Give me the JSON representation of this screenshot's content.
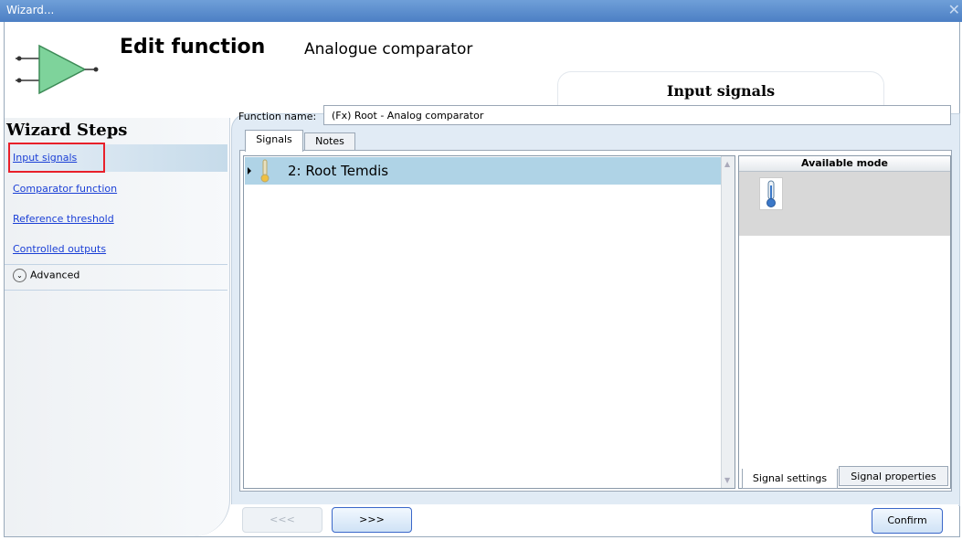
{
  "window": {
    "title": "Wizard...",
    "close_glyph": "✕"
  },
  "header": {
    "icon": "analogue-comparator-icon",
    "title": "Edit function",
    "subtitle": "Analogue comparator",
    "current_step": "Input signals"
  },
  "sidebar": {
    "title": "Wizard Steps",
    "steps": [
      {
        "label": "Input signals",
        "active": true
      },
      {
        "label": "Comparator function",
        "active": false
      },
      {
        "label": "Reference threshold",
        "active": false
      },
      {
        "label": "Controlled outputs",
        "active": false
      }
    ],
    "advanced_label": "Advanced"
  },
  "main": {
    "function_name_label": "Function name:",
    "function_name_value": "(Fx) Root - Analog comparator",
    "tabs": [
      {
        "label": "Signals",
        "selected": true
      },
      {
        "label": "Notes",
        "selected": false
      }
    ],
    "signals": [
      {
        "label": "2: Root Temdis",
        "icon": "thermometer-icon"
      }
    ],
    "available_mode": {
      "header": "Available mode",
      "icon": "thermometer-icon"
    },
    "bottom_tabs": [
      {
        "label": "Signal settings",
        "selected": true
      },
      {
        "label": "Signal properties",
        "selected": false
      }
    ]
  },
  "buttons": {
    "prev": "<<<",
    "next": ">>>",
    "confirm": "Confirm"
  },
  "colors": {
    "title_bar": "#5a8cd0",
    "highlight_border": "#e8202a",
    "link": "#1a3fd6",
    "selected_row": "#afd3e6"
  }
}
